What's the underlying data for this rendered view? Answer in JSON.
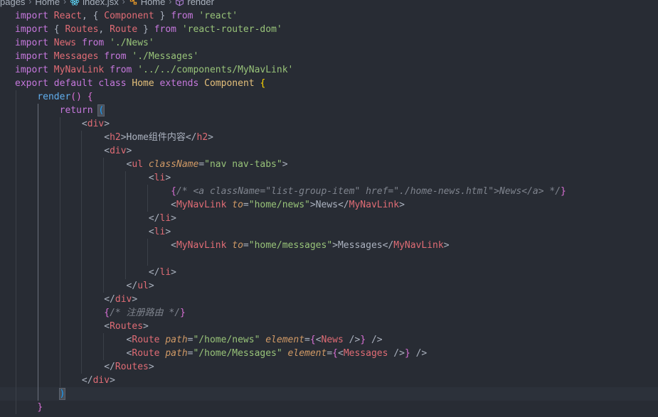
{
  "breadcrumb": {
    "items": [
      "pages",
      "Home",
      "index.jsx",
      "Home",
      "render"
    ]
  },
  "editor": {
    "lines": [
      [
        {
          "t": "import",
          "c": "kw"
        },
        {
          "t": " "
        },
        {
          "t": "React",
          "c": "var"
        },
        {
          "t": ", { "
        },
        {
          "t": "Component",
          "c": "var"
        },
        {
          "t": " } "
        },
        {
          "t": "from",
          "c": "kw"
        },
        {
          "t": " "
        },
        {
          "t": "'react'",
          "c": "str"
        }
      ],
      [
        {
          "t": "import",
          "c": "kw"
        },
        {
          "t": " { "
        },
        {
          "t": "Routes",
          "c": "var"
        },
        {
          "t": ", "
        },
        {
          "t": "Route",
          "c": "var"
        },
        {
          "t": " } "
        },
        {
          "t": "from",
          "c": "kw"
        },
        {
          "t": " "
        },
        {
          "t": "'react-router-dom'",
          "c": "str"
        }
      ],
      [
        {
          "t": "import",
          "c": "kw"
        },
        {
          "t": " "
        },
        {
          "t": "News",
          "c": "var"
        },
        {
          "t": " "
        },
        {
          "t": "from",
          "c": "kw"
        },
        {
          "t": " "
        },
        {
          "t": "'./News'",
          "c": "str"
        }
      ],
      [
        {
          "t": "import",
          "c": "kw"
        },
        {
          "t": " "
        },
        {
          "t": "Messages",
          "c": "var"
        },
        {
          "t": " "
        },
        {
          "t": "from",
          "c": "kw"
        },
        {
          "t": " "
        },
        {
          "t": "'./Messages'",
          "c": "str"
        }
      ],
      [
        {
          "t": "import",
          "c": "kw"
        },
        {
          "t": " "
        },
        {
          "t": "MyNavLink",
          "c": "var"
        },
        {
          "t": " "
        },
        {
          "t": "from",
          "c": "kw"
        },
        {
          "t": " "
        },
        {
          "t": "'../../components/MyNavLink'",
          "c": "str"
        }
      ],
      [
        {
          "t": "export",
          "c": "kw"
        },
        {
          "t": " "
        },
        {
          "t": "default",
          "c": "kw"
        },
        {
          "t": " "
        },
        {
          "t": "class",
          "c": "kw"
        },
        {
          "t": " "
        },
        {
          "t": "Home",
          "c": "class"
        },
        {
          "t": " "
        },
        {
          "t": "extends",
          "c": "kw"
        },
        {
          "t": " "
        },
        {
          "t": "Component",
          "c": "class"
        },
        {
          "t": " "
        },
        {
          "t": "{",
          "c": "brace2"
        }
      ],
      [
        {
          "t": "    "
        },
        {
          "t": "render",
          "c": "fn"
        },
        {
          "t": "()",
          "c": "brace"
        },
        {
          "t": " "
        },
        {
          "t": "{",
          "c": "brace"
        }
      ],
      [
        {
          "t": "        "
        },
        {
          "t": "return",
          "c": "kw"
        },
        {
          "t": " "
        },
        {
          "t": "(",
          "c": "paren",
          "m": true
        }
      ],
      [
        {
          "t": "            "
        },
        {
          "t": "<"
        },
        {
          "t": "div",
          "c": "tag"
        },
        {
          "t": ">"
        }
      ],
      [
        {
          "t": "                "
        },
        {
          "t": "<"
        },
        {
          "t": "h2",
          "c": "tag"
        },
        {
          "t": ">"
        },
        {
          "t": "Home组件内容"
        },
        {
          "t": "</"
        },
        {
          "t": "h2",
          "c": "tag"
        },
        {
          "t": ">"
        }
      ],
      [
        {
          "t": "                "
        },
        {
          "t": "<"
        },
        {
          "t": "div",
          "c": "tag"
        },
        {
          "t": ">"
        }
      ],
      [
        {
          "t": "                    "
        },
        {
          "t": "<"
        },
        {
          "t": "ul",
          "c": "tag"
        },
        {
          "t": " "
        },
        {
          "t": "className",
          "c": "attr"
        },
        {
          "t": "="
        },
        {
          "t": "\"nav nav-tabs\"",
          "c": "str"
        },
        {
          "t": ">"
        }
      ],
      [
        {
          "t": "                        "
        },
        {
          "t": "<"
        },
        {
          "t": "li",
          "c": "tag"
        },
        {
          "t": ">"
        }
      ],
      [
        {
          "t": "                            "
        },
        {
          "t": "{",
          "c": "brace"
        },
        {
          "t": "/* <a className=\"list-group-item\" href=\"./home-news.html\">News</a> */",
          "c": "comment"
        },
        {
          "t": "}",
          "c": "brace"
        }
      ],
      [
        {
          "t": "                            "
        },
        {
          "t": "<"
        },
        {
          "t": "MyNavLink",
          "c": "tag"
        },
        {
          "t": " "
        },
        {
          "t": "to",
          "c": "attr"
        },
        {
          "t": "="
        },
        {
          "t": "\"home/news\"",
          "c": "str"
        },
        {
          "t": ">"
        },
        {
          "t": "News"
        },
        {
          "t": "</"
        },
        {
          "t": "MyNavLink",
          "c": "tag"
        },
        {
          "t": ">"
        }
      ],
      [
        {
          "t": "                        "
        },
        {
          "t": "</"
        },
        {
          "t": "li",
          "c": "tag"
        },
        {
          "t": ">"
        }
      ],
      [
        {
          "t": "                        "
        },
        {
          "t": "<"
        },
        {
          "t": "li",
          "c": "tag"
        },
        {
          "t": ">"
        }
      ],
      [
        {
          "t": "                            "
        },
        {
          "t": "<"
        },
        {
          "t": "MyNavLink",
          "c": "tag"
        },
        {
          "t": " "
        },
        {
          "t": "to",
          "c": "attr"
        },
        {
          "t": "="
        },
        {
          "t": "\"home/messages\"",
          "c": "str"
        },
        {
          "t": ">"
        },
        {
          "t": "Messages"
        },
        {
          "t": "</"
        },
        {
          "t": "MyNavLink",
          "c": "tag"
        },
        {
          "t": ">"
        }
      ],
      [],
      [
        {
          "t": "                        "
        },
        {
          "t": "</"
        },
        {
          "t": "li",
          "c": "tag"
        },
        {
          "t": ">"
        }
      ],
      [
        {
          "t": "                    "
        },
        {
          "t": "</"
        },
        {
          "t": "ul",
          "c": "tag"
        },
        {
          "t": ">"
        }
      ],
      [
        {
          "t": "                "
        },
        {
          "t": "</"
        },
        {
          "t": "div",
          "c": "tag"
        },
        {
          "t": ">"
        }
      ],
      [
        {
          "t": "                "
        },
        {
          "t": "{",
          "c": "brace"
        },
        {
          "t": "/* 注册路由 */",
          "c": "comment"
        },
        {
          "t": "}",
          "c": "brace"
        }
      ],
      [
        {
          "t": "                "
        },
        {
          "t": "<"
        },
        {
          "t": "Routes",
          "c": "tag"
        },
        {
          "t": ">"
        }
      ],
      [
        {
          "t": "                    "
        },
        {
          "t": "<"
        },
        {
          "t": "Route",
          "c": "tag"
        },
        {
          "t": " "
        },
        {
          "t": "path",
          "c": "attr"
        },
        {
          "t": "="
        },
        {
          "t": "\"/home/news\"",
          "c": "str"
        },
        {
          "t": " "
        },
        {
          "t": "element",
          "c": "attr"
        },
        {
          "t": "="
        },
        {
          "t": "{",
          "c": "brace"
        },
        {
          "t": "<"
        },
        {
          "t": "News",
          "c": "tag"
        },
        {
          "t": " />"
        },
        {
          "t": "}",
          "c": "brace"
        },
        {
          "t": " />"
        }
      ],
      [
        {
          "t": "                    "
        },
        {
          "t": "<"
        },
        {
          "t": "Route",
          "c": "tag"
        },
        {
          "t": " "
        },
        {
          "t": "path",
          "c": "attr"
        },
        {
          "t": "="
        },
        {
          "t": "\"/home/Messages\"",
          "c": "str"
        },
        {
          "t": " "
        },
        {
          "t": "element",
          "c": "attr"
        },
        {
          "t": "="
        },
        {
          "t": "{",
          "c": "brace"
        },
        {
          "t": "<"
        },
        {
          "t": "Messages",
          "c": "tag"
        },
        {
          "t": " />"
        },
        {
          "t": "}",
          "c": "brace"
        },
        {
          "t": " />"
        }
      ],
      [
        {
          "t": "                "
        },
        {
          "t": "</"
        },
        {
          "t": "Routes",
          "c": "tag"
        },
        {
          "t": ">"
        }
      ],
      [
        {
          "t": "            "
        },
        {
          "t": "</"
        },
        {
          "t": "div",
          "c": "tag"
        },
        {
          "t": ">"
        }
      ],
      [
        {
          "t": "        "
        },
        {
          "t": ")",
          "c": "paren",
          "m": true
        }
      ],
      [
        {
          "t": "    "
        },
        {
          "t": "}",
          "c": "brace"
        }
      ]
    ],
    "current_line": 28,
    "indent_levels": [
      0,
      0,
      0,
      0,
      0,
      0,
      1,
      2,
      3,
      4,
      4,
      5,
      6,
      7,
      7,
      6,
      6,
      7,
      7,
      6,
      5,
      4,
      4,
      4,
      5,
      5,
      4,
      3,
      2,
      1
    ]
  }
}
